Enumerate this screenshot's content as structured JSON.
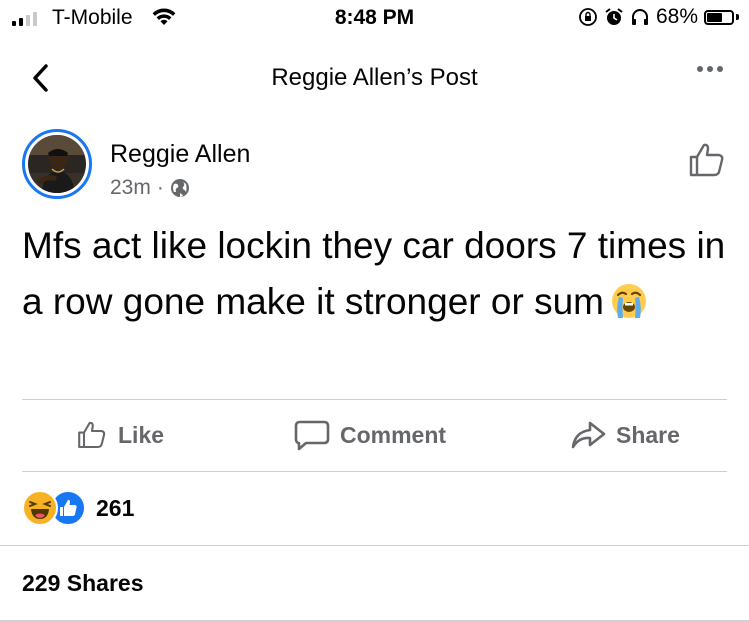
{
  "status_bar": {
    "carrier": "T-Mobile",
    "time": "8:48 PM",
    "battery_percent": "68%",
    "battery_level": 0.68,
    "signal_bars_filled": 2,
    "signal_bars_total": 4,
    "icons": [
      "signal-icon",
      "wifi-icon",
      "orientation-lock-icon",
      "alarm-icon",
      "headphones-icon",
      "battery-icon"
    ]
  },
  "nav": {
    "title": "Reggie Allen’s Post",
    "back_icon": "chevron-left-icon",
    "more_icon": "more-dots-icon"
  },
  "post": {
    "author": "Reggie Allen",
    "time": "23m",
    "separator": "·",
    "privacy_icon": "globe-icon",
    "text": "Mfs act like lockin they car doors 7 times in a row gone make it stronger or sum",
    "text_emoji": "loudly-crying-face-emoji",
    "like_page_icon": "thumbs-up-outline-icon"
  },
  "actions": {
    "like": "Like",
    "comment": "Comment",
    "share": "Share"
  },
  "reactions": {
    "types": [
      "haha-reaction-icon",
      "like-reaction-icon"
    ],
    "count": "261"
  },
  "shares": {
    "label": "229 Shares"
  },
  "colors": {
    "accent": "#1877f2",
    "secondary_text": "#65676b",
    "primary_text": "#050505",
    "divider": "#ced0d4",
    "haha_yellow": "#f7b125"
  }
}
